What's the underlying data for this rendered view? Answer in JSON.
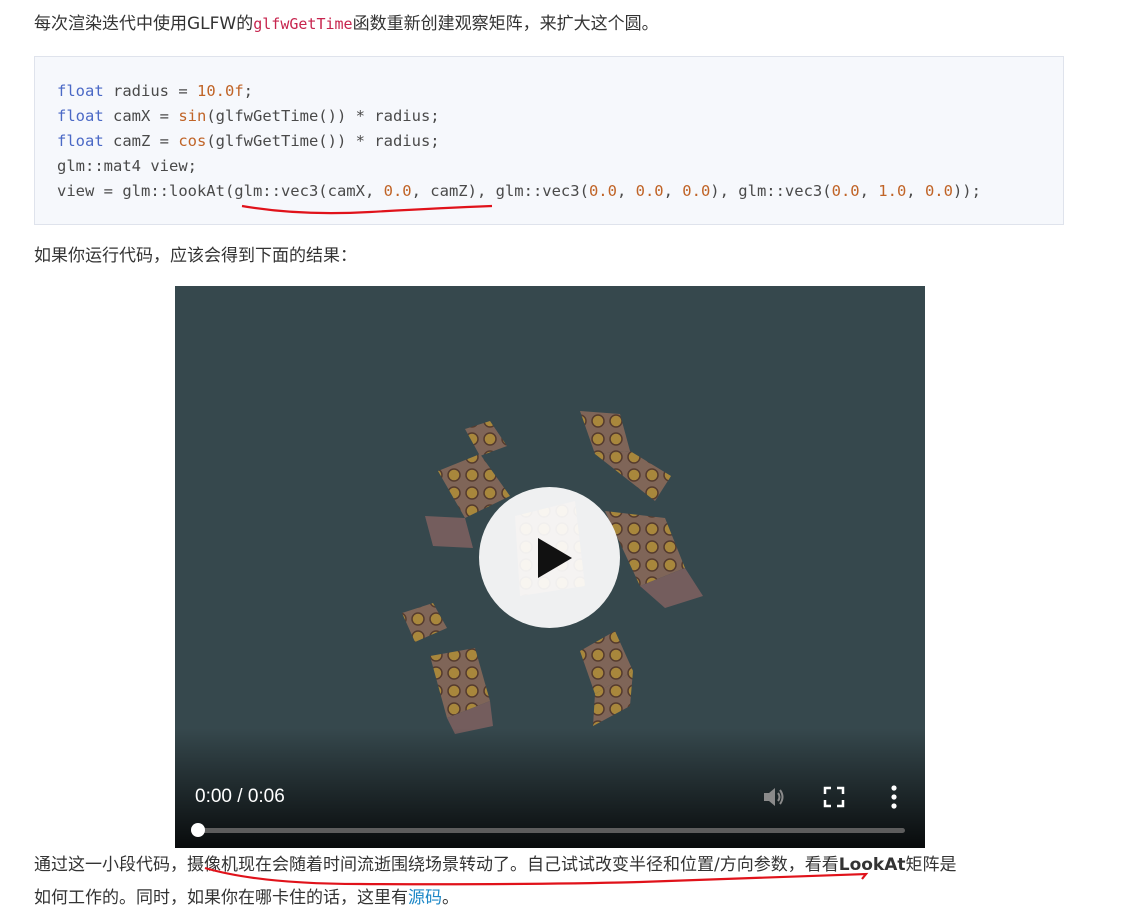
{
  "intro": {
    "before": "每次渲染迭代中使用GLFW的",
    "code": "glfwGetTime",
    "after": "函数重新创建观察矩阵，来扩大这个圆。"
  },
  "code_lines": [
    [
      [
        "kw",
        "float"
      ],
      [
        "t",
        " radius = "
      ],
      [
        "num",
        "10.0f"
      ],
      [
        "t",
        ";"
      ]
    ],
    [
      [
        "kw",
        "float"
      ],
      [
        "t",
        " camX = "
      ],
      [
        "fn",
        "sin"
      ],
      [
        "t",
        "(glfwGetTime()) * radius;"
      ]
    ],
    [
      [
        "kw",
        "float"
      ],
      [
        "t",
        " camZ = "
      ],
      [
        "fn",
        "cos"
      ],
      [
        "t",
        "(glfwGetTime()) * radius;"
      ]
    ],
    [
      [
        "t",
        "glm::mat4 view;"
      ]
    ],
    [
      [
        "t",
        "view = glm::lookAt(glm::vec3(camX, "
      ],
      [
        "num",
        "0.0"
      ],
      [
        "t",
        ", camZ), glm::vec3("
      ],
      [
        "num",
        "0.0"
      ],
      [
        "t",
        ", "
      ],
      [
        "num",
        "0.0"
      ],
      [
        "t",
        ", "
      ],
      [
        "num",
        "0.0"
      ],
      [
        "t",
        "), glm::vec3("
      ],
      [
        "num",
        "0.0"
      ],
      [
        "t",
        ", "
      ],
      [
        "num",
        "1.0"
      ],
      [
        "t",
        ", "
      ],
      [
        "num",
        "0.0"
      ],
      [
        "t",
        "));"
      ]
    ]
  ],
  "result_text": "如果你运行代码，应该会得到下面的结果：",
  "video": {
    "time_label": "0:00 / 0:06",
    "progress": 0,
    "background": "#36484d"
  },
  "outro": {
    "line1_before": "通过这一小段代码，",
    "line1_highlight": "摄像机现在会随着时间流逝围绕场景转动了。自己试试改变半径和位置/方向参数",
    "line1_after": "，看看",
    "line1_bold": "LookAt",
    "line1_end": "矩阵是",
    "line2_before": "如何工作的。同时，如果你在哪卡住的话，这里有",
    "line2_link": "源码",
    "line2_end": "。"
  },
  "colors": {
    "keyword": "#4b69c6",
    "number": "#c06427",
    "link": "#1e88c7",
    "annotation": "#e0121a"
  },
  "icons": [
    "play-icon",
    "volume-icon",
    "fullscreen-icon",
    "more-vert-icon"
  ]
}
